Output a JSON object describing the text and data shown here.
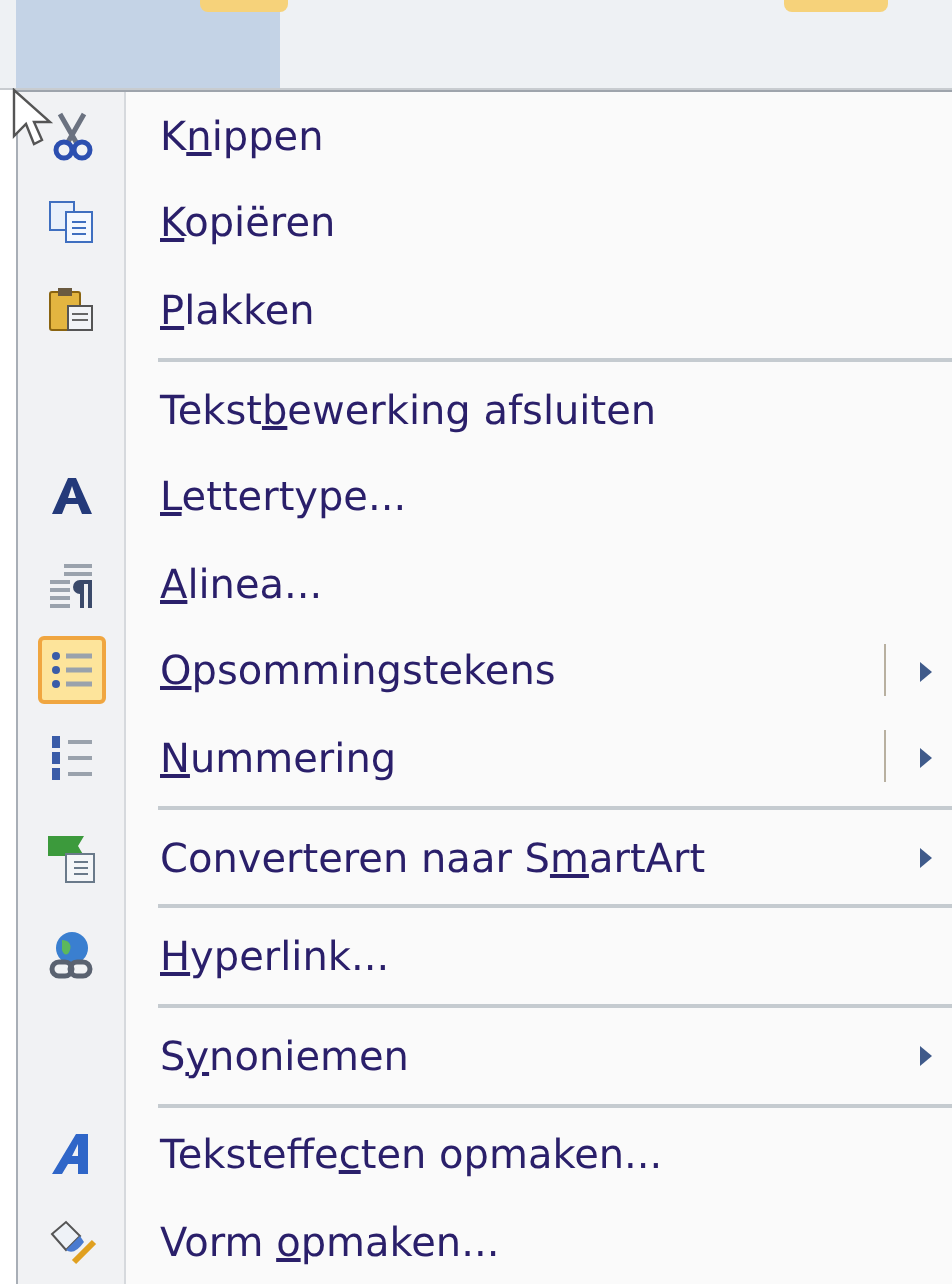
{
  "menu": {
    "items": [
      {
        "kind": "item",
        "text": {
          "before": "K",
          "key": "n",
          "after": "ippen"
        },
        "checked": false,
        "submenu": false,
        "split": false
      },
      {
        "kind": "item",
        "text": {
          "key": "K",
          "after": "opiëren"
        },
        "checked": false,
        "submenu": false,
        "split": false
      },
      {
        "kind": "item",
        "text": {
          "key": "P",
          "after": "lakken"
        },
        "checked": false,
        "submenu": false,
        "split": false
      },
      {
        "kind": "separator"
      },
      {
        "kind": "item",
        "text": {
          "before": "Tekst",
          "key": "b",
          "after": "ewerking afsluiten"
        },
        "checked": false,
        "submenu": false,
        "split": false
      },
      {
        "kind": "item",
        "text": {
          "key": "L",
          "after": "ettertype..."
        },
        "checked": false,
        "submenu": false,
        "split": false
      },
      {
        "kind": "item",
        "text": {
          "key": "A",
          "after": "linea..."
        },
        "checked": false,
        "submenu": false,
        "split": false
      },
      {
        "kind": "item",
        "text": {
          "key": "O",
          "after": "psommingstekens"
        },
        "checked": true,
        "submenu": true,
        "split": true
      },
      {
        "kind": "item",
        "text": {
          "key": "N",
          "after": "ummering"
        },
        "checked": false,
        "submenu": true,
        "split": true
      },
      {
        "kind": "separator"
      },
      {
        "kind": "item",
        "text": {
          "before": "Converteren naar S",
          "key": "m",
          "after": "artArt"
        },
        "checked": false,
        "submenu": true,
        "split": false
      },
      {
        "kind": "separator"
      },
      {
        "kind": "item",
        "text": {
          "key": "H",
          "after": "yperlink..."
        },
        "checked": false,
        "submenu": false,
        "split": false
      },
      {
        "kind": "separator"
      },
      {
        "kind": "item",
        "text": {
          "before": "S",
          "key": "y",
          "after": "noniemen"
        },
        "checked": false,
        "submenu": true,
        "split": false
      },
      {
        "kind": "separator"
      },
      {
        "kind": "item",
        "text": {
          "before": "Teksteffe",
          "key": "c",
          "after": "ten opmaken..."
        },
        "checked": false,
        "submenu": false,
        "split": false
      },
      {
        "kind": "item",
        "text": {
          "before": "Vorm ",
          "key": "o",
          "after": "pmaken..."
        },
        "checked": false,
        "submenu": false,
        "split": false
      }
    ]
  }
}
